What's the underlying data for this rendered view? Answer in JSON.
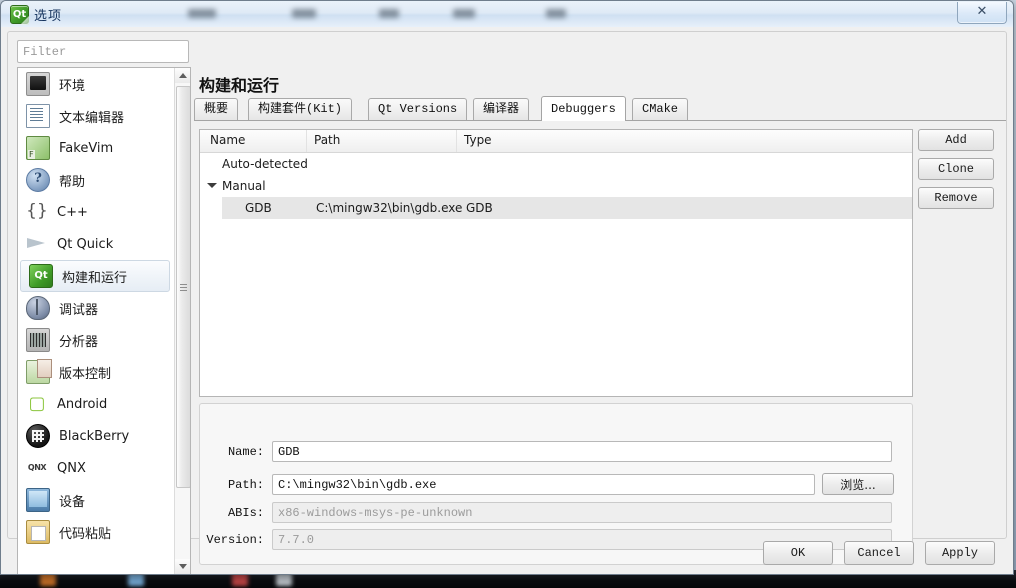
{
  "window": {
    "title": "选项",
    "logo_text": "Qt",
    "close_label": "✕"
  },
  "filter": {
    "placeholder": "Filter",
    "value": ""
  },
  "sidebar": {
    "items": [
      {
        "label": "环境",
        "icon": "monitor-icon",
        "selected": false
      },
      {
        "label": "文本编辑器",
        "icon": "text-editor-icon",
        "selected": false
      },
      {
        "label": "FakeVim",
        "icon": "fakevim-icon",
        "selected": false
      },
      {
        "label": "帮助",
        "icon": "help-icon",
        "selected": false
      },
      {
        "label": "C++",
        "icon": "braces-icon",
        "selected": false
      },
      {
        "label": "Qt Quick",
        "icon": "paper-plane-icon",
        "selected": false
      },
      {
        "label": "构建和运行",
        "icon": "qt-build-icon",
        "selected": true
      },
      {
        "label": "调试器",
        "icon": "bug-icon",
        "selected": false
      },
      {
        "label": "分析器",
        "icon": "analyzer-icon",
        "selected": false
      },
      {
        "label": "版本控制",
        "icon": "version-control-icon",
        "selected": false
      },
      {
        "label": "Android",
        "icon": "android-icon",
        "selected": false
      },
      {
        "label": "BlackBerry",
        "icon": "blackberry-icon",
        "selected": false
      },
      {
        "label": "QNX",
        "icon": "qnx-icon",
        "selected": false
      },
      {
        "label": "设备",
        "icon": "device-icon",
        "selected": false
      },
      {
        "label": "代码粘贴",
        "icon": "paste-icon",
        "selected": false
      }
    ]
  },
  "page": {
    "title": "构建和运行",
    "tabs": [
      {
        "label": "概要",
        "active": false
      },
      {
        "label": "构建套件(Kit)",
        "active": false
      },
      {
        "label": "Qt Versions",
        "active": false
      },
      {
        "label": "编译器",
        "active": false
      },
      {
        "label": "Debuggers",
        "active": true
      },
      {
        "label": "CMake",
        "active": false
      }
    ]
  },
  "table": {
    "columns": [
      "Name",
      "Path",
      "Type"
    ],
    "rows": [
      {
        "name": "Auto-detected",
        "path": "",
        "type": "",
        "level": 0,
        "expander": "",
        "selected": false
      },
      {
        "name": "Manual",
        "path": "",
        "type": "",
        "level": 0,
        "expander": "expanded",
        "selected": false
      },
      {
        "name": "GDB",
        "path": "C:\\mingw32\\bin\\gdb.exe",
        "type": "GDB",
        "level": 1,
        "expander": "",
        "selected": true
      }
    ]
  },
  "side_buttons": {
    "add": "Add",
    "clone": "Clone",
    "remove": "Remove"
  },
  "form": {
    "name_label": "Name:",
    "name_value": "GDB",
    "path_label": "Path:",
    "path_value": "C:\\mingw32\\bin\\gdb.exe",
    "browse_label": "浏览...",
    "abis_label": "ABIs:",
    "abis_value": "x86-windows-msys-pe-unknown",
    "version_label": "Version:",
    "version_value": "7.7.0"
  },
  "footer": {
    "ok": "OK",
    "cancel": "Cancel",
    "apply": "Apply"
  },
  "colors": {
    "accent": "#3f9b28",
    "selection": "#e6e6e6",
    "title_text": "#13315c"
  }
}
